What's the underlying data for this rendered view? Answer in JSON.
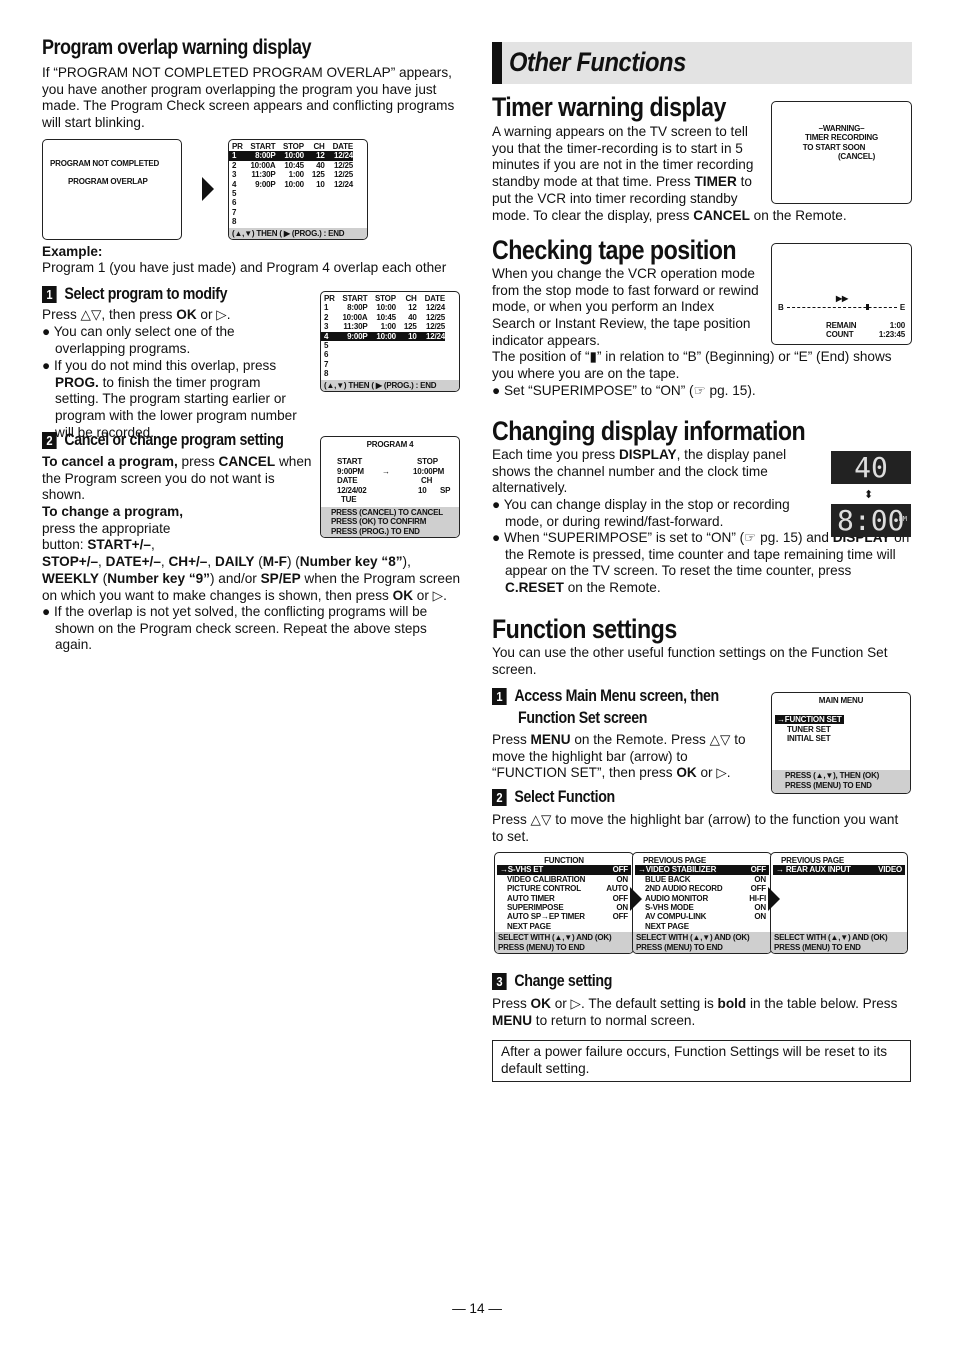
{
  "left": {
    "overlap": {
      "title": "Program overlap warning display",
      "intro": [
        {
          "t": "If “PROGRAM NOT COMPLETED PROGRAM OVERLAP” appears, you have another program overlapping the program you have just made. The Program Check screen appears and conflicting programs will start blinking."
        }
      ],
      "warn_screen": [
        "PROGRAM NOT COMPLETED",
        "PROGRAM OVERLAP"
      ],
      "example_label": "Example:",
      "example_text": "Program 1 (you have just made) and Program 4 overlap each other"
    },
    "step1": {
      "num": "1",
      "title": "Select program to modify",
      "p1": [
        {
          "t": "Press △▽, then press "
        },
        {
          "t": "OK",
          "b": 1
        },
        {
          "t": " or ▷."
        }
      ],
      "b1": [
        {
          "t": "● You can only select one of the overlapping programs."
        }
      ],
      "b2": [
        {
          "t": "● If you do not mind this overlap, press "
        },
        {
          "t": "PROG.",
          "b": 1
        },
        {
          "t": " to finish the timer program setting. The program starting earlier or program with the lower program number will be recorded."
        }
      ]
    },
    "step2": {
      "num": "2",
      "title": "Cancel or change program setting",
      "p1": [
        {
          "t": "To cancel a program,",
          "b": 1
        },
        {
          "t": " press "
        },
        {
          "t": "CANCEL",
          "b": 1
        },
        {
          "t": " when the Program screen you do not want is shown."
        }
      ],
      "p2": [
        {
          "t": "To change a program,",
          "b": 1
        },
        {
          "t": " press the appropriate button: "
        },
        {
          "t": "START+/–",
          "b": 1
        },
        {
          "t": ", "
        },
        {
          "t": "STOP+/–",
          "b": 1
        },
        {
          "t": ", "
        },
        {
          "t": "DATE+/–",
          "b": 1
        },
        {
          "t": ", "
        },
        {
          "t": "CH+/–",
          "b": 1
        },
        {
          "t": ", "
        },
        {
          "t": "DAILY",
          "b": 1
        },
        {
          "t": " ("
        },
        {
          "t": "M-F",
          "b": 1
        },
        {
          "t": ") ("
        },
        {
          "t": "Number key “8”",
          "b": 1
        },
        {
          "t": "), "
        },
        {
          "t": "WEEKLY",
          "b": 1
        },
        {
          "t": " ("
        },
        {
          "t": "Number key “9”",
          "b": 1
        },
        {
          "t": ") and/or "
        },
        {
          "t": "SP/EP",
          "b": 1
        },
        {
          "t": " when the Program screen on which you want to make changes is shown, then press "
        },
        {
          "t": "OK",
          "b": 1
        },
        {
          "t": " or ▷."
        }
      ],
      "b1": [
        {
          "t": "● If the overlap is not yet solved, the conflicting programs will be shown on the Program check screen. Repeat the above steps again."
        }
      ]
    }
  },
  "prog_table": {
    "headers": [
      "PR",
      "START",
      "STOP",
      "CH",
      "DATE"
    ],
    "rows": [
      [
        "1",
        "8:00P",
        "10:00",
        "12",
        "12/24"
      ],
      [
        "2",
        "10:00A",
        "10:45",
        "40",
        "12/25"
      ],
      [
        "3",
        "11:30P",
        "1:00",
        "125",
        "12/25"
      ],
      [
        "4",
        "9:00P",
        "10:00",
        "10",
        "12/24"
      ],
      [
        "5",
        "",
        "",
        "",
        ""
      ],
      [
        "6",
        "",
        "",
        "",
        ""
      ],
      [
        "7",
        "",
        "",
        "",
        ""
      ],
      [
        "8",
        "",
        "",
        "",
        ""
      ]
    ],
    "footer": "(▲,▼) THEN ( ▶ (PROG.) : END"
  },
  "prog4_screen": {
    "title": "PROGRAM 4",
    "start_label": "START",
    "start": "9:00PM",
    "arrow": "→",
    "stop_label": "STOP",
    "stop": "10:00PM",
    "date_label": "DATE",
    "date": "12/24/02",
    "day": "TUE",
    "ch_label": "CH",
    "ch": "10",
    "sp": "SP",
    "footer": [
      "PRESS (CANCEL) TO CANCEL",
      "PRESS (OK) TO CONFIRM",
      "PRESS (PROG.) TO END"
    ]
  },
  "right": {
    "banner": "Other Functions",
    "timer": {
      "title": "Timer warning display",
      "p": [
        {
          "t": "A warning appears on the TV screen to tell you that the timer-recording is to start in 5 minutes if you are not in the timer recording standby mode at that time. Press "
        },
        {
          "t": "TIMER",
          "b": 1
        },
        {
          "t": " to put the VCR into timer recording standby mode. To clear the display, press "
        },
        {
          "t": "CANCEL",
          "b": 1
        },
        {
          "t": " on the Remote."
        }
      ],
      "screen": [
        "–WARNING–",
        "TIMER RECORDING",
        "TO START SOON",
        "(CANCEL)"
      ]
    },
    "tape": {
      "title": "Checking tape position",
      "p1": [
        {
          "t": "When you change the VCR operation mode from the stop mode to fast forward or rewind mode, or when you perform an Index Search or Instant Review, the tape position indicator appears."
        }
      ],
      "p2": [
        {
          "t": "The position of “▮” in relation to “B” (Beginning) or “E” (End) shows you where you are on the tape."
        }
      ],
      "b1": [
        {
          "t": "● Set “SUPERIMPOSE” to “ON” (☞ pg. 15)."
        }
      ],
      "screen": {
        "ff": "▶▶",
        "b": "B",
        "e": "E",
        "remain_label": "REMAIN",
        "remain": "1:00",
        "count_label": "COUNT",
        "count": "1:23:45"
      }
    },
    "display": {
      "title": "Changing display information",
      "p1": [
        {
          "t": "Each time you press "
        },
        {
          "t": "DISPLAY",
          "b": 1
        },
        {
          "t": ", the display panel shows the channel number and the clock time alternatively."
        }
      ],
      "b1": [
        {
          "t": "● You can change display in the stop or recording mode, or during rewind/fast-forward."
        }
      ],
      "b2": [
        {
          "t": "● When “SUPERIMPOSE” is set to “ON” (☞ pg. 15) and "
        },
        {
          "t": "DISPLAY",
          "b": 1
        },
        {
          "t": " on the Remote is pressed, time counter and tape remaining time will appear on the TV screen. To reset the time counter, press "
        },
        {
          "t": "C.RESET",
          "b": 1
        },
        {
          "t": " on the Remote."
        }
      ],
      "lcd_channel": "40",
      "lcd_clock": "8:00",
      "lcd_pm": "PM"
    },
    "function": {
      "title": "Function settings",
      "intro": [
        {
          "t": "You can use the other useful function settings on the Function Set screen."
        }
      ],
      "step1": {
        "num": "1",
        "title1": "Access Main Menu screen, then",
        "title2": "Function Set screen",
        "p": [
          {
            "t": "Press "
          },
          {
            "t": "MENU",
            "b": 1
          },
          {
            "t": " on the Remote. Press △▽ to move the highlight bar (arrow) to “FUNCTION SET”, then press "
          },
          {
            "t": "OK",
            "b": 1
          },
          {
            "t": " or ▷."
          }
        ]
      },
      "main_menu": {
        "title": "MAIN MENU",
        "items": [
          "→FUNCTION SET",
          "TUNER SET",
          "INITIAL SET"
        ],
        "footer": [
          "PRESS (▲,▼), THEN (OK)",
          "PRESS (MENU) TO END"
        ]
      },
      "step2": {
        "num": "2",
        "title": "Select Function",
        "p": [
          {
            "t": "Press △▽ to move the highlight bar (arrow) to the function you want to set."
          }
        ]
      },
      "screens": [
        {
          "title": "FUNCTION",
          "items": [
            [
              "→S-VHS ET",
              "OFF"
            ],
            [
              "VIDEO CALIBRATION",
              "ON"
            ],
            [
              "PICTURE CONTROL",
              "AUTO"
            ],
            [
              "AUTO TIMER",
              "OFF"
            ],
            [
              "SUPERIMPOSE",
              "ON"
            ],
            [
              "AUTO SP→EP TIMER",
              "OFF"
            ],
            [
              "NEXT PAGE",
              ""
            ]
          ]
        },
        {
          "title": "PREVIOUS PAGE",
          "items": [
            [
              "→VIDEO STABILIZER",
              "OFF"
            ],
            [
              "BLUE BACK",
              "ON"
            ],
            [
              "2ND AUDIO RECORD",
              "OFF"
            ],
            [
              "AUDIO MONITOR",
              "HI-FI"
            ],
            [
              "S-VHS MODE",
              "ON"
            ],
            [
              "AV COMPU-LINK",
              "ON"
            ],
            [
              "NEXT PAGE",
              ""
            ]
          ]
        },
        {
          "title": "PREVIOUS PAGE",
          "items": [
            [
              "→ REAR AUX INPUT",
              "VIDEO"
            ]
          ]
        }
      ],
      "screen_footer": [
        "SELECT WITH (▲,▼) AND (OK)",
        "PRESS (MENU) TO END"
      ],
      "step3": {
        "num": "3",
        "title": "Change setting",
        "p": [
          {
            "t": "Press "
          },
          {
            "t": "OK",
            "b": 1
          },
          {
            "t": " or ▷. The default setting is "
          },
          {
            "t": "bold",
            "b": 1
          },
          {
            "t": " in the table below. Press "
          },
          {
            "t": "MENU",
            "b": 1
          },
          {
            "t": " to return to normal screen."
          }
        ]
      },
      "note": "After a power failure occurs, Function Settings will be reset to its default setting."
    }
  },
  "page_number": "— 14 —"
}
